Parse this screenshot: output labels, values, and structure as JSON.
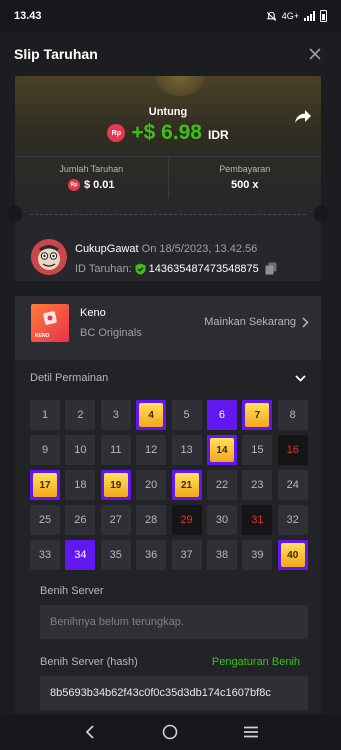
{
  "status_bar": {
    "time": "13.43",
    "network": "4G+"
  },
  "header": {
    "title": "Slip Taruhan"
  },
  "summary": {
    "profit_label": "Untung",
    "currency_badge": "Rp",
    "profit_amount": "+$ 6.98",
    "profit_currency": "IDR",
    "bet_label": "Jumlah Taruhan",
    "bet_amount": "$ 0.01",
    "payout_label": "Pembayaran",
    "payout_value": "500 x"
  },
  "user": {
    "name": "CukupGawat",
    "date": "On 18/5/2023, 13.42.56",
    "bet_id_label": "ID Taruhan:",
    "bet_id": "143635487473548875"
  },
  "game": {
    "name": "Keno",
    "provider": "BC Originals",
    "play_label": "Mainkan Sekarang",
    "thumb_text": "KENO"
  },
  "details": {
    "title": "Detil Permainan",
    "cells": [
      {
        "n": "1",
        "s": "normal"
      },
      {
        "n": "2",
        "s": "normal"
      },
      {
        "n": "3",
        "s": "normal"
      },
      {
        "n": "4",
        "s": "hit"
      },
      {
        "n": "5",
        "s": "normal"
      },
      {
        "n": "6",
        "s": "picked"
      },
      {
        "n": "7",
        "s": "hit"
      },
      {
        "n": "8",
        "s": "normal"
      },
      {
        "n": "9",
        "s": "normal"
      },
      {
        "n": "10",
        "s": "normal"
      },
      {
        "n": "11",
        "s": "normal"
      },
      {
        "n": "12",
        "s": "normal"
      },
      {
        "n": "13",
        "s": "normal"
      },
      {
        "n": "14",
        "s": "hit"
      },
      {
        "n": "15",
        "s": "normal"
      },
      {
        "n": "16",
        "s": "miss"
      },
      {
        "n": "17",
        "s": "hit"
      },
      {
        "n": "18",
        "s": "normal"
      },
      {
        "n": "19",
        "s": "hit"
      },
      {
        "n": "20",
        "s": "normal"
      },
      {
        "n": "21",
        "s": "hit"
      },
      {
        "n": "22",
        "s": "normal"
      },
      {
        "n": "23",
        "s": "normal"
      },
      {
        "n": "24",
        "s": "normal"
      },
      {
        "n": "25",
        "s": "normal"
      },
      {
        "n": "26",
        "s": "normal"
      },
      {
        "n": "27",
        "s": "normal"
      },
      {
        "n": "28",
        "s": "normal"
      },
      {
        "n": "29",
        "s": "miss"
      },
      {
        "n": "30",
        "s": "normal"
      },
      {
        "n": "31",
        "s": "miss"
      },
      {
        "n": "32",
        "s": "normal"
      },
      {
        "n": "33",
        "s": "normal"
      },
      {
        "n": "34",
        "s": "picked"
      },
      {
        "n": "35",
        "s": "normal"
      },
      {
        "n": "36",
        "s": "normal"
      },
      {
        "n": "37",
        "s": "normal"
      },
      {
        "n": "38",
        "s": "normal"
      },
      {
        "n": "39",
        "s": "normal"
      },
      {
        "n": "40",
        "s": "hit"
      }
    ],
    "server_seed_label": "Benih Server",
    "server_seed_value": "Benihnya belum terungkap.",
    "hash_label": "Benih Server (hash)",
    "seed_settings_label": "Pengaturan Benih",
    "hash_value": "8b5693b34b62f43c0f0c35d3db174c1607bf8c"
  },
  "colors": {
    "accent_green": "#3bc117",
    "picked_purple": "#6317f0",
    "miss_red": "#e0332f",
    "gold": "#f3a71e"
  }
}
